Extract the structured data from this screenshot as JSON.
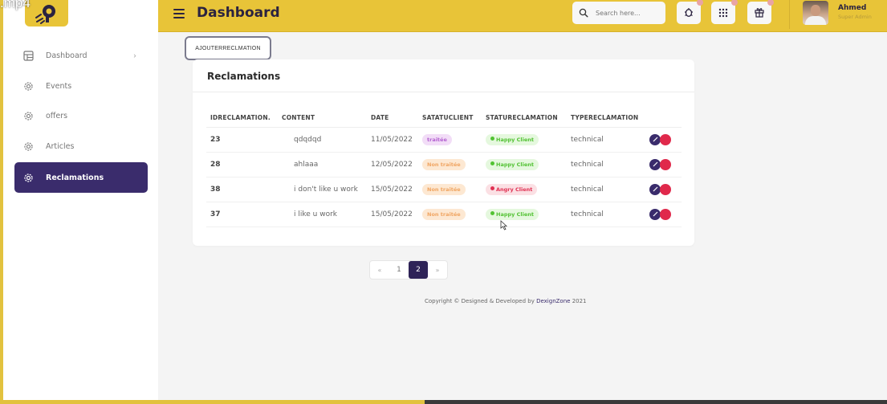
{
  "video_tag": ".mp4",
  "header": {
    "title": "Dashboard",
    "search_placeholder": "Search here...",
    "user_name": "Ahmed",
    "user_role": "Super Admin"
  },
  "sidebar": {
    "items": [
      {
        "label": "Dashboard",
        "icon": "grid-icon",
        "chevron": "›"
      },
      {
        "label": "Events",
        "icon": "gear-icon"
      },
      {
        "label": "offers",
        "icon": "gear-icon"
      },
      {
        "label": "Articles",
        "icon": "gear-icon"
      },
      {
        "label": "Reclamations",
        "icon": "gear-icon",
        "active": true
      }
    ]
  },
  "main": {
    "add_button": "AJOUTERRECLMATION",
    "card_title": "Reclamations",
    "columns": [
      "IDRECLAMATION.",
      "CONTENT",
      "DATE",
      "SATATUCLIENT",
      "STATURECLAMATION",
      "TYPERECLAMATION"
    ],
    "rows": [
      {
        "id": "23",
        "content": "qdqdqd",
        "date": "11/05/2022",
        "statut_client": "traitée",
        "statut_reclamation": "Happy Client",
        "type": "technical"
      },
      {
        "id": "28",
        "content": "ahlaaa",
        "date": "12/05/2022",
        "statut_client": "Non traitée",
        "statut_reclamation": "Happy Client",
        "type": "technical"
      },
      {
        "id": "38",
        "content": "i don't like u work",
        "date": "15/05/2022",
        "statut_client": "Non traitée",
        "statut_reclamation": "Angry Client",
        "type": "technical"
      },
      {
        "id": "37",
        "content": "i like u work",
        "date": "15/05/2022",
        "statut_client": "Non traitée",
        "statut_reclamation": "Happy Client",
        "type": "technical"
      }
    ]
  },
  "pagination": {
    "prev": "«",
    "pages": [
      "1",
      "2"
    ],
    "current": "2",
    "next": "»"
  },
  "footer": {
    "prefix": "Copyright © Designed & Developed by ",
    "brand": "DexignZone",
    "suffix": " 2021"
  },
  "colors": {
    "accent_yellow": "#e8c438",
    "primary_purple": "#3a2c6c",
    "delete_red": "#e0294b"
  }
}
